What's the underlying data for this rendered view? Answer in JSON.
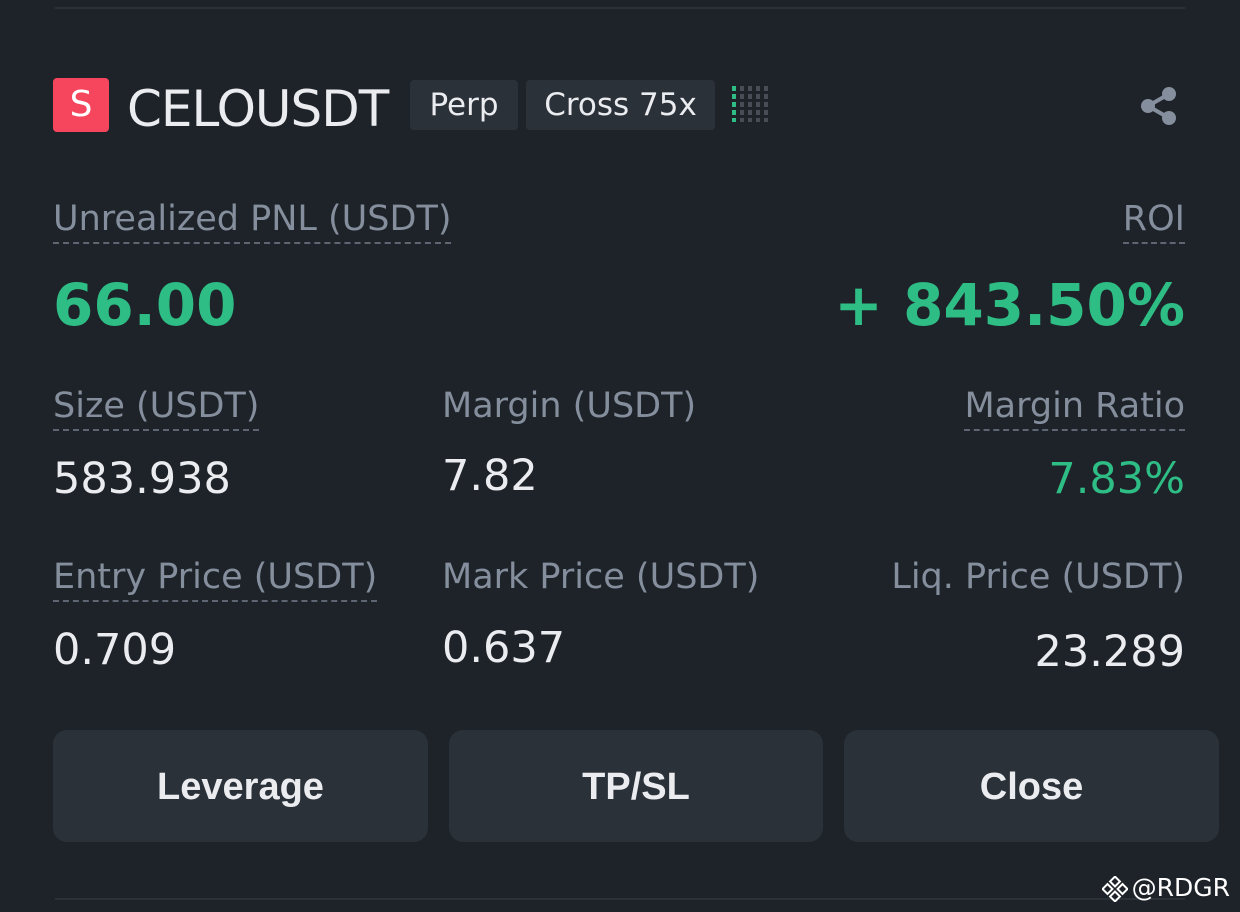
{
  "position": {
    "side_badge": "S",
    "symbol": "CELOUSDT",
    "contract_type": "Perp",
    "margin_mode": "Cross 75x",
    "risk_level": {
      "active_bars": 1,
      "total_bars": 5
    },
    "share_icon": "share-icon"
  },
  "pnl": {
    "label": "Unrealized PNL (USDT)",
    "value": "66.00"
  },
  "roi": {
    "label": "ROI",
    "value": "+ 843.50%"
  },
  "size": {
    "label": "Size (USDT)",
    "value": "583.938"
  },
  "margin": {
    "label": "Margin (USDT)",
    "value": "7.82"
  },
  "margin_ratio": {
    "label": "Margin Ratio",
    "value": "7.83%"
  },
  "entry_price": {
    "label": "Entry Price (USDT)",
    "value": "0.709"
  },
  "mark_price": {
    "label": "Mark Price (USDT)",
    "value": "0.637"
  },
  "liq_price": {
    "label": "Liq. Price (USDT)",
    "value": "23.289"
  },
  "buttons": {
    "leverage": "Leverage",
    "tpsl": "TP/SL",
    "close": "Close"
  },
  "watermark": {
    "text": "@RDGR",
    "icon": "binance-logo-icon"
  },
  "colors": {
    "background": "#1e2329",
    "card": "#2b3139",
    "positive": "#2ebd85",
    "sell_badge": "#f6465d",
    "muted_text": "#848e9c",
    "primary_text": "#eaecef"
  }
}
